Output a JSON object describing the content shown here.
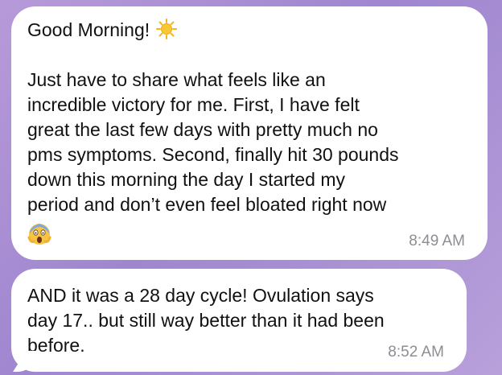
{
  "messages": [
    {
      "greeting": "Good Morning!",
      "greeting_emoji": "sun-emoji",
      "body": "Just have to share what feels like an\nincredible victory for me. First, I have felt\ngreat the last few days with pretty much no\npms symptoms. Second, finally hit 30 pounds\ndown this morning the day I started my\nperiod and don’t even feel bloated right now",
      "trailing_emoji": "screaming-face-emoji",
      "time": "8:49 AM"
    },
    {
      "body": "AND it was a 28 day cycle! Ovulation says\nday 17.. but still way better than it had been\nbefore.",
      "time": "8:52 AM"
    }
  ],
  "colors": {
    "background": "#a98fd4",
    "bubble": "#ffffff",
    "text": "#111111",
    "timestamp": "#8d8d93"
  }
}
